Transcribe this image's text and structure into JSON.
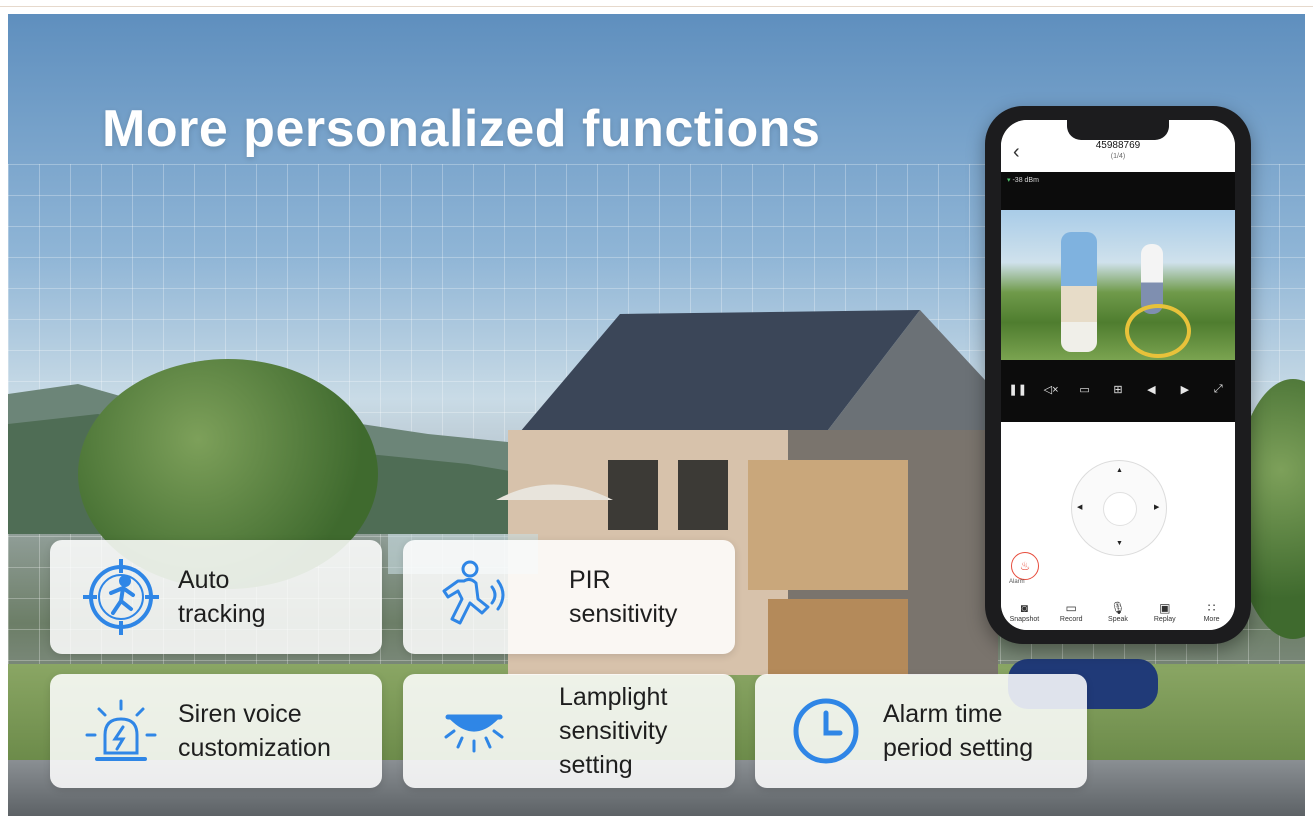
{
  "title": "More personalized functions",
  "colors": {
    "accent": "#2f86e6",
    "alarm": "#e74c3c"
  },
  "features": [
    {
      "label": "Auto\ntracking",
      "icon": "auto-tracking-icon"
    },
    {
      "label": "PIR\nsensitivity",
      "icon": "pir-motion-icon"
    },
    {
      "label": "Siren voice\ncustomization",
      "icon": "siren-icon"
    },
    {
      "label": "Lamplight\nsensitivity\nsetting",
      "icon": "lamp-icon"
    },
    {
      "label": "Alarm time\nperiod setting",
      "icon": "clock-icon"
    }
  ],
  "phone": {
    "device_id": "45988769",
    "device_sub": "(1/4)",
    "signal": "-38 dBm",
    "alarm_label": "Alarm",
    "toolbar": [
      "Snapshot",
      "Record",
      "Speak",
      "Replay",
      "More"
    ]
  }
}
